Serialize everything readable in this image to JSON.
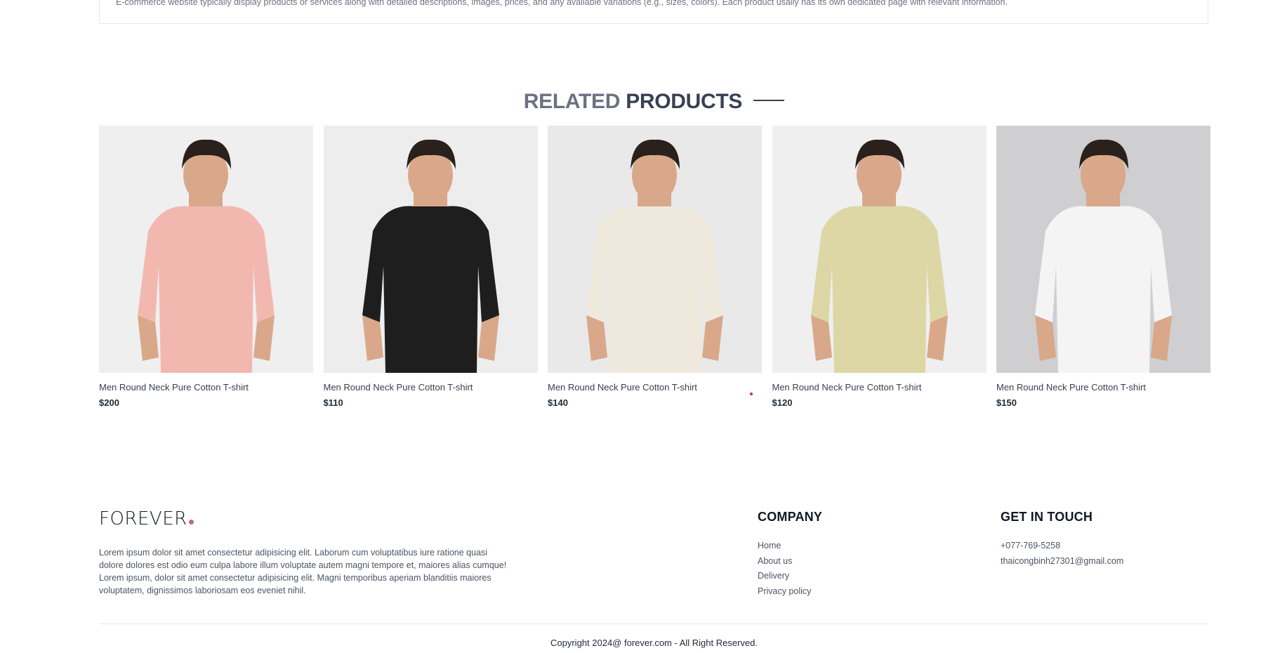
{
  "description": {
    "text": "E-commerce website typically display products or services along with detailed descriptions, images, prices, and any available variations (e.g., sizes, colors). Each product usally has its own dedicated page with relevant information."
  },
  "related": {
    "title_light": "RELATED",
    "title_bold": "PRODUCTS",
    "products": [
      {
        "name": "Men Round Neck Pure Cotton T-shirt",
        "price": "$200",
        "shirt_color": "#f2b8b0",
        "bg": "#efeff0"
      },
      {
        "name": "Men Round Neck Pure Cotton T-shirt",
        "price": "$110",
        "shirt_color": "#1e1e1e",
        "bg": "#ededee"
      },
      {
        "name": "Men Round Neck Pure Cotton T-shirt",
        "price": "$140",
        "shirt_color": "#efe9dd",
        "bg": "#e9e9ea"
      },
      {
        "name": "Men Round Neck Pure Cotton T-shirt",
        "price": "$120",
        "shirt_color": "#ddd7a6",
        "bg": "#efeff0"
      },
      {
        "name": "Men Round Neck Pure Cotton T-shirt",
        "price": "$150",
        "shirt_color": "#f4f4f5",
        "bg": "#cfcfd1"
      }
    ]
  },
  "footer": {
    "logo": "FOREVER",
    "logo_dot_color": "#c26a7f",
    "about": "Lorem ipsum dolor sit amet consectetur adipisicing elit. Laborum cum voluptatibus iure ratione quasi dolore dolores est odio eum culpa labore illum voluptate autem magni tempore et, maiores alias cumque! Lorem ipsum, dolor sit amet consectetur adipisicing elit. Magni temporibus aperiam blanditiis maiores voluptatem, dignissimos laboriosam eos eveniet nihil.",
    "company": {
      "title": "COMPANY",
      "links": [
        "Home",
        "About us",
        "Delivery",
        "Privacy policy"
      ]
    },
    "contact": {
      "title": "GET IN TOUCH",
      "phone": "+077-769-5258",
      "email": "thaicongbinh27301@gmail.com"
    },
    "copyright": "Copyright 2024@ forever.com - All Right Reserved."
  }
}
